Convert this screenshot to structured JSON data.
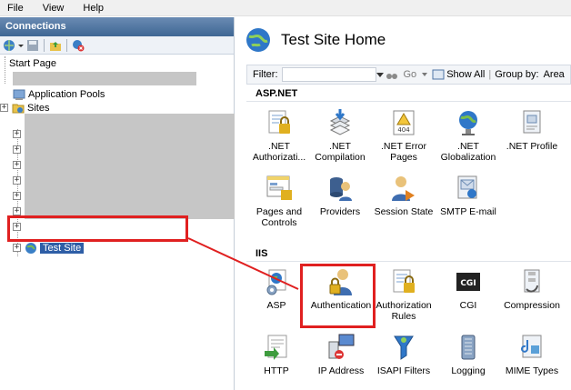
{
  "menubar": {
    "items": [
      "File",
      "View",
      "Help"
    ]
  },
  "connections": {
    "header": "Connections",
    "tree": {
      "start_page": "Start Page",
      "application_pools": "Application Pools",
      "sites": "Sites",
      "test_site": "Test Site",
      "expander_symbol": "+"
    }
  },
  "main": {
    "title": "Test Site Home",
    "filter_label": "Filter:",
    "go_label": "Go",
    "show_all_label": "Show All",
    "group_by_label": "Group by:",
    "group_by_value": "Area"
  },
  "sections": [
    {
      "title": "ASP.NET",
      "items": [
        {
          "label": ".NET Authorizati...",
          "icon": "net-authorization-icon"
        },
        {
          "label": ".NET Compilation",
          "icon": "net-compilation-icon"
        },
        {
          "label": ".NET Error Pages",
          "icon": "net-error-pages-icon"
        },
        {
          "label": ".NET Globalization",
          "icon": "net-globalization-icon"
        },
        {
          "label": ".NET Profile",
          "icon": "net-profile-icon"
        },
        {
          "label": "Pages and Controls",
          "icon": "pages-and-controls-icon"
        },
        {
          "label": "Providers",
          "icon": "providers-icon"
        },
        {
          "label": "Session State",
          "icon": "session-state-icon"
        },
        {
          "label": "SMTP E-mail",
          "icon": "smtp-email-icon"
        }
      ]
    },
    {
      "title": "IIS",
      "items": [
        {
          "label": "ASP",
          "icon": "asp-icon"
        },
        {
          "label": "Authentication",
          "icon": "authentication-icon"
        },
        {
          "label": "Authorization Rules",
          "icon": "authorization-rules-icon"
        },
        {
          "label": "CGI",
          "icon": "cgi-icon"
        },
        {
          "label": "Compression",
          "icon": "compression-icon"
        },
        {
          "label": "HTTP",
          "icon": "http-icon"
        },
        {
          "label": "IP Address",
          "icon": "ip-address-icon"
        },
        {
          "label": "ISAPI Filters",
          "icon": "isapi-filters-icon"
        },
        {
          "label": "Logging",
          "icon": "logging-icon"
        },
        {
          "label": "MIME Types",
          "icon": "mime-types-icon"
        }
      ]
    }
  ],
  "icon_text": {
    "error_404": "404",
    "cgi": "CGI"
  },
  "colors": {
    "highlight": "#e02020",
    "selection": "#2e5ea6",
    "header": "#3f6794"
  }
}
